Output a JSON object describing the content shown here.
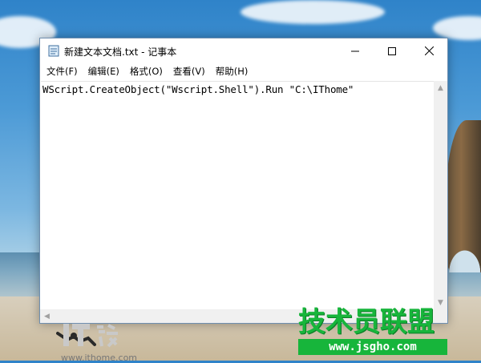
{
  "window": {
    "title": "新建文本文档.txt - 记事本",
    "controls": {
      "minimize_icon": "minimize-icon",
      "maximize_icon": "maximize-icon",
      "close_icon": "close-icon"
    }
  },
  "menu": {
    "items": [
      {
        "label": "文件(F)"
      },
      {
        "label": "编辑(E)"
      },
      {
        "label": "格式(O)"
      },
      {
        "label": "查看(V)"
      },
      {
        "label": "帮助(H)"
      }
    ]
  },
  "editor": {
    "content": "WScript.CreateObject(\"Wscript.Shell\").Run \"C:\\IThome\""
  },
  "ithome": {
    "url": "www.ithome.com"
  },
  "watermark": {
    "title": "技术员联盟",
    "url": "www.jsgho.com"
  },
  "colors": {
    "watermark_green": "#17b53b",
    "window_border": "#6f8fb0"
  }
}
